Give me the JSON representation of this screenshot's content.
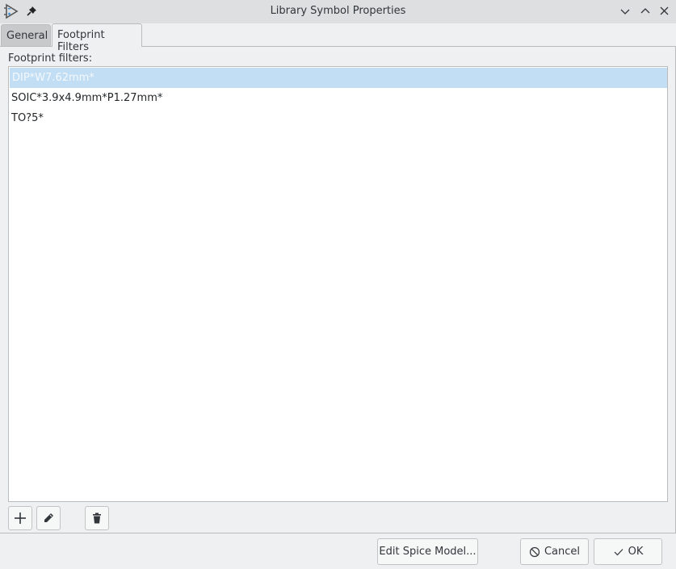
{
  "window": {
    "title": "Library Symbol Properties",
    "icons": {
      "app": "kicad-symbol-editor-icon",
      "pin": "pin-icon",
      "minimize": "chevron-down-icon",
      "maximize": "chevron-up-icon",
      "close": "close-icon"
    }
  },
  "tabs": [
    {
      "label": "General",
      "active": false
    },
    {
      "label": "Footprint Filters",
      "active": true
    }
  ],
  "footprint_filters": {
    "label": "Footprint filters:",
    "items": [
      {
        "value": "DIP*W7.62mm*",
        "selected": true
      },
      {
        "value": "SOIC*3.9x4.9mm*P1.27mm*",
        "selected": false
      },
      {
        "value": "TO?5*",
        "selected": false
      }
    ]
  },
  "toolbar": {
    "add": "plus-icon",
    "edit": "pencil-icon",
    "delete": "trash-icon"
  },
  "buttons": {
    "edit_spice": "Edit Spice Model...",
    "cancel": "Cancel",
    "ok": "OK"
  },
  "colors": {
    "selection": "#c2def4",
    "background": "#eff0f1",
    "titlebar": "#dedfe0"
  }
}
